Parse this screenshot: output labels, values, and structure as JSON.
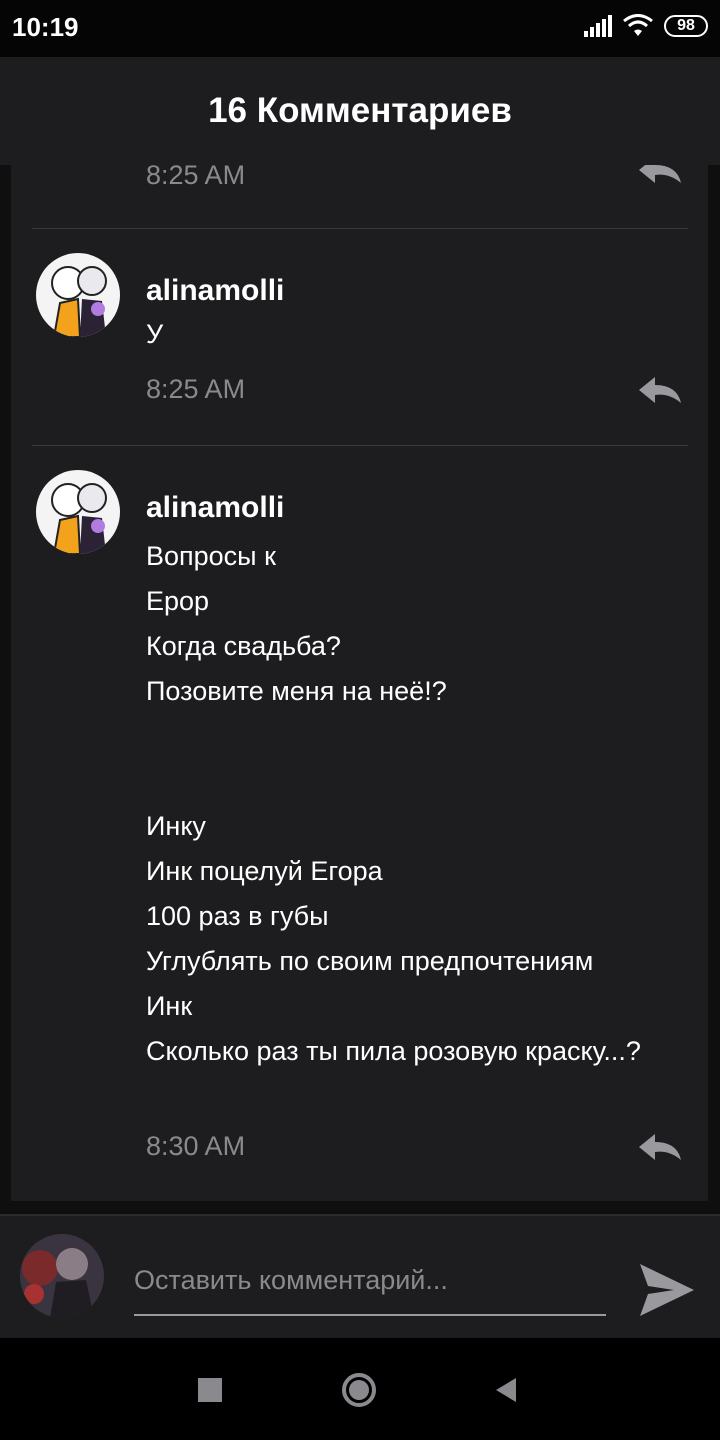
{
  "status_bar": {
    "time": "10:19",
    "battery": "98",
    "icons": [
      "signal-icon",
      "wifi-icon",
      "battery-icon"
    ]
  },
  "header": {
    "title": "16 Комментариев"
  },
  "comments": [
    {
      "time": "8:25 AM",
      "partial": true
    },
    {
      "author": "alinamolli",
      "text": "У",
      "time": "8:25 AM"
    },
    {
      "author": "alinamolli",
      "text": "Вопросы к\nЕрор\nКогда свадьба?\nПозовите меня на неё!?\n\n\nИнку\nИнк поцелуй Егора\n100 раз в губы\nУглублять по своим предпочтениям\nИнк\nСколько раз ты пила розовую краску...?",
      "time": "8:30 AM"
    }
  ],
  "composer": {
    "placeholder": "Оставить комментарий..."
  },
  "colors": {
    "background": "#0f0f10",
    "card": "#1d1d1f",
    "text": "#ffffff",
    "muted": "#8a8a8e",
    "divider": "#3a3a3c"
  }
}
